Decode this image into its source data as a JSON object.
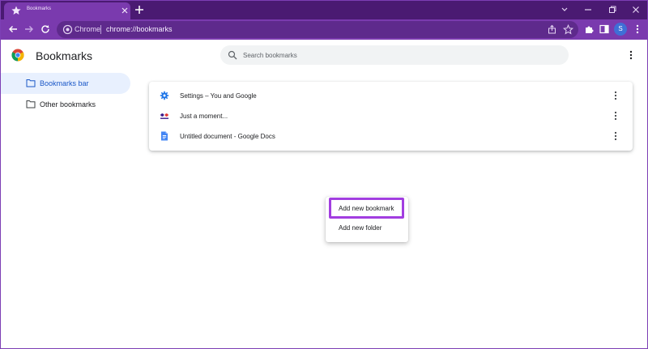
{
  "tab": {
    "title": "Bookmarks"
  },
  "address": {
    "label": "Chrome",
    "url": "chrome://bookmarks"
  },
  "profile": {
    "initial": "S"
  },
  "page": {
    "title": "Bookmarks"
  },
  "search": {
    "placeholder": "Search bookmarks"
  },
  "sidebar": {
    "items": [
      {
        "label": "Bookmarks bar",
        "active": true
      },
      {
        "label": "Other bookmarks",
        "active": false
      }
    ]
  },
  "bookmarks": [
    {
      "title": "Settings – You and Google",
      "icon": "gear-icon"
    },
    {
      "title": "Just a moment...",
      "icon": "site-favicon"
    },
    {
      "title": "Untitled document - Google Docs",
      "icon": "docs-icon"
    }
  ],
  "context_menu": {
    "items": [
      {
        "label": "Add new bookmark",
        "highlighted": true
      },
      {
        "label": "Add new folder"
      }
    ]
  },
  "colors": {
    "frame": "#7a3aae",
    "tabbar": "#4a1a72",
    "accent_blue": "#1a57c7",
    "highlight": "#a23ee0"
  }
}
